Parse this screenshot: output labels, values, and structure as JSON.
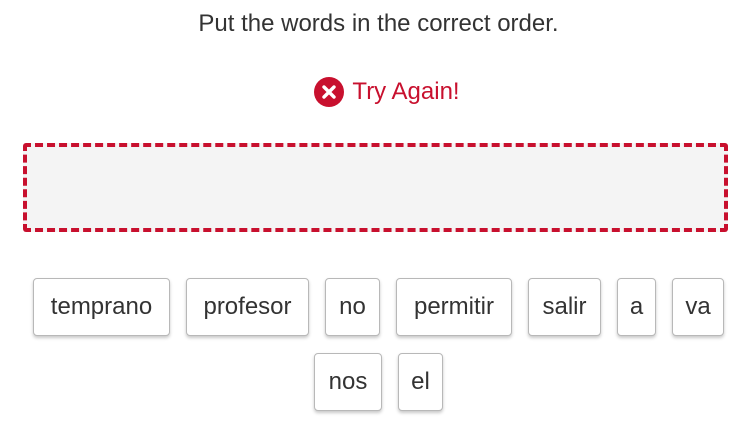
{
  "instruction": "Put the words in the correct order.",
  "feedback": {
    "icon": "close-circle-icon",
    "text": "Try Again!",
    "color": "#c8102e"
  },
  "dropzone": {
    "border_color": "#c8102e",
    "background": "#f4f4f4"
  },
  "words": [
    "temprano",
    "profesor",
    "no",
    "permitir",
    "salir",
    "a",
    "va",
    "nos",
    "el"
  ]
}
